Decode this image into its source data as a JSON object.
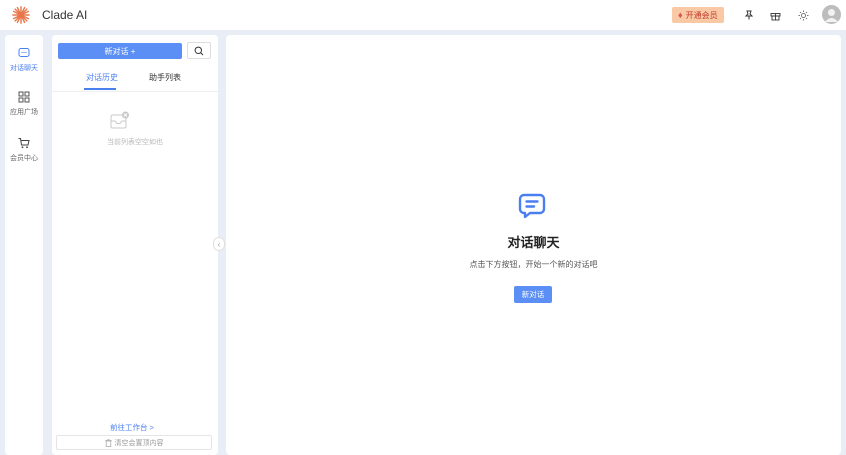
{
  "app": {
    "title": "Clade AI",
    "brand_color": "#e8764a",
    "accent_color": "#5b8ff5"
  },
  "topbar": {
    "vip_label": "开通会员",
    "icons": [
      "gem-icon",
      "pin-icon",
      "gift-icon",
      "sun-icon",
      "avatar"
    ]
  },
  "rail": {
    "items": [
      {
        "label": "对话聊天",
        "icon": "chat-icon",
        "active": true
      },
      {
        "label": "应用广场",
        "icon": "grid-icon",
        "active": false
      },
      {
        "label": "会员中心",
        "icon": "cart-icon",
        "active": false
      }
    ]
  },
  "panel": {
    "new_chat_label": "新对话 +",
    "tabs": [
      {
        "label": "对话历史",
        "active": true
      },
      {
        "label": "助手列表",
        "active": false
      }
    ],
    "empty_text": "当前列表空空如也",
    "workspace_link": "前往工作台 >",
    "clear_label": "清空会置顶内容"
  },
  "main": {
    "title": "对话聊天",
    "subtitle": "点击下方按钮，开始一个新的对话吧",
    "new_chat_button": "新对话"
  }
}
